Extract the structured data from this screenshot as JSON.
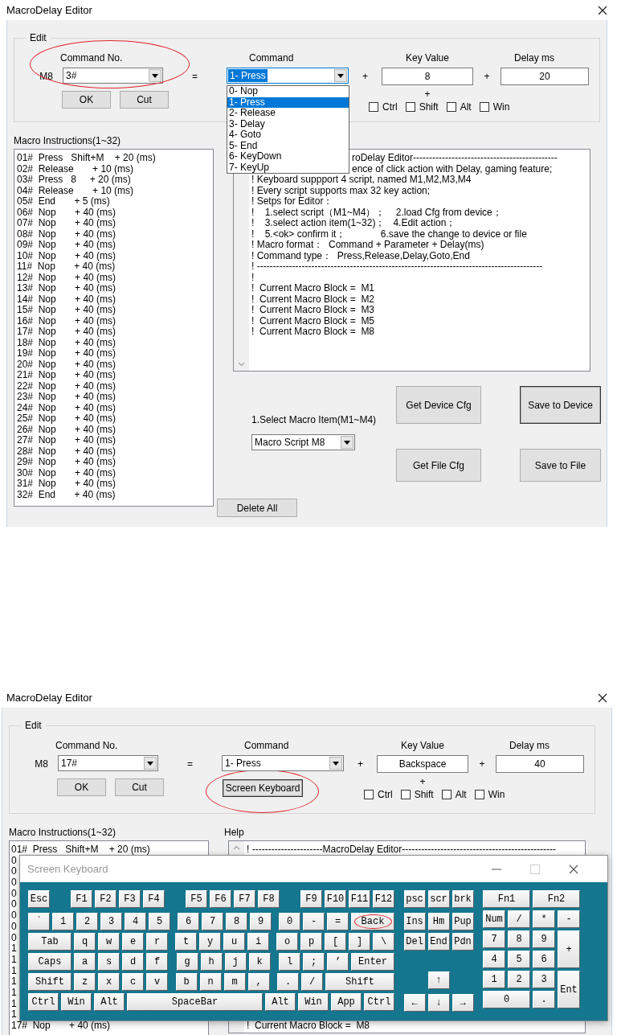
{
  "windows": [
    {
      "title": "MacroDelay Editor",
      "edit": {
        "legend": "Edit",
        "command_no": {
          "label": "Command No.",
          "prefix": "M8",
          "value": "3#",
          "highlighted": true
        },
        "equals": "=",
        "command": {
          "label": "Command",
          "value": "1- Press",
          "focused": true,
          "expanded": true,
          "options": [
            {
              "label": "0- Nop",
              "selected": false
            },
            {
              "label": "1- Press",
              "selected": true
            },
            {
              "label": "2- Release",
              "selected": false
            },
            {
              "label": "3- Delay",
              "selected": false
            },
            {
              "label": "4- Goto",
              "selected": false
            },
            {
              "label": "5- End",
              "selected": false
            },
            {
              "label": "6- KeyDown",
              "selected": false
            },
            {
              "label": "7- KeyUp",
              "selected": false
            }
          ]
        },
        "plus_1": "+",
        "key_value": {
          "label": "Key Value",
          "value": "8"
        },
        "plus_2": "+",
        "delay": {
          "label": "Delay ms",
          "value": "20"
        },
        "buttons": [
          "OK",
          "Cut"
        ],
        "plus_3": "+",
        "modifiers": [
          {
            "label": "Ctrl",
            "checked": false
          },
          {
            "label": "Shift",
            "checked": false
          },
          {
            "label": "Alt",
            "checked": false
          },
          {
            "label": "Win",
            "checked": false
          }
        ]
      },
      "macro_instructions": {
        "label": "Macro Instructions(1~32)",
        "rows": [
          "01#  Press   Shift+M    + 20 (ms)",
          "02#  Release       + 10 (ms)",
          "03#  Press   8     + 20 (ms)",
          "04#  Release       + 10 (ms)",
          "05#  End       + 5 (ms)",
          "06#  Nop       + 40 (ms)",
          "07#  Nop       + 40 (ms)",
          "08#  Nop       + 40 (ms)",
          "09#  Nop       + 40 (ms)",
          "10#  Nop       + 40 (ms)",
          "11#  Nop       + 40 (ms)",
          "12#  Nop       + 40 (ms)",
          "13#  Nop       + 40 (ms)",
          "14#  Nop       + 40 (ms)",
          "15#  Nop       + 40 (ms)",
          "16#  Nop       + 40 (ms)",
          "17#  Nop       + 40 (ms)",
          "18#  Nop       + 40 (ms)",
          "19#  Nop       + 40 (ms)",
          "20#  Nop       + 40 (ms)",
          "21#  Nop       + 40 (ms)",
          "22#  Nop       + 40 (ms)",
          "23#  Nop       + 40 (ms)",
          "24#  Nop       + 40 (ms)",
          "25#  Nop       + 40 (ms)",
          "26#  Nop       + 40 (ms)",
          "27#  Nop       + 40 (ms)",
          "28#  Nop       + 40 (ms)",
          "29#  Nop       + 40 (ms)",
          "30#  Nop       + 40 (ms)",
          "31#  Nop       + 40 (ms)",
          "32#  End       + 40 (ms)"
        ]
      },
      "help": {
        "lines": [
          {
            "kind": "cut",
            "text": "roDelay Editor---------------------------------------------"
          },
          {
            "kind": "cut",
            "text": "ence of click action with Delay, gaming feature;"
          },
          {
            "kind": "text",
            "text": "! Keyboard suppport 4 script, named M1,M2,M3,M4"
          },
          {
            "kind": "text",
            "text": "! Every script supports max 32 key action;"
          },
          {
            "kind": "text",
            "text": "! Setps for Editor："
          },
          {
            "kind": "text",
            "text": "!    1.select script（M1~M4）；    2.load Cfg from device；"
          },
          {
            "kind": "text",
            "text": "!    3.select action item(1~32)；   4.Edit action；"
          },
          {
            "kind": "text",
            "text": "!    5.<ok> confirm it；             6.save the change to device or file"
          },
          {
            "kind": "text",
            "text": "! Macro format：  Command + Parameter + Delay(ms)"
          },
          {
            "kind": "text",
            "text": "! Command type：  Press,Release,Delay,Goto,End"
          },
          {
            "kind": "text",
            "text": "! -----------------------------------------------------------------------------------------"
          },
          {
            "kind": "text",
            "text": "!"
          },
          {
            "kind": "text",
            "text": "!  Current Macro Block =  M1"
          },
          {
            "kind": "text",
            "text": "!  Current Macro Block =  M2"
          },
          {
            "kind": "text",
            "text": "!  Current Macro Block =  M3"
          },
          {
            "kind": "text",
            "text": "!  Current Macro Block =  M5"
          },
          {
            "kind": "text",
            "text": "!  Current Macro Block =  M8"
          }
        ]
      },
      "select_macro": {
        "label": "1.Select Macro Item(M1~M4)",
        "value": "Macro Script M8"
      },
      "action_buttons": [
        {
          "label": "Get Device Cfg",
          "default": false
        },
        {
          "label": "Save to Device",
          "default": true
        },
        {
          "label": "Get File Cfg",
          "default": false
        },
        {
          "label": "Save to File",
          "default": false
        }
      ],
      "delete_all": "Delete All"
    },
    {
      "title": "MacroDelay Editor",
      "edit": {
        "legend": "Edit",
        "command_no": {
          "label": "Command No.",
          "prefix": "M8",
          "value": "17#",
          "highlighted": false
        },
        "equals": "=",
        "command": {
          "label": "Command",
          "value": "1- Press",
          "focused": false,
          "expanded": false
        },
        "plus_1": "+",
        "key_value": {
          "label": "Key Value",
          "value": "Backspace"
        },
        "plus_2": "+",
        "delay": {
          "label": "Delay ms",
          "value": "40"
        },
        "buttons": [
          "OK",
          "Cut"
        ],
        "screen_keyboard_button": {
          "label": "Screen Keyboard",
          "default": true,
          "highlighted": true
        },
        "plus_3": "+",
        "modifiers": [
          {
            "label": "Ctrl",
            "checked": false
          },
          {
            "label": "Shift",
            "checked": false
          },
          {
            "label": "Alt",
            "checked": false
          },
          {
            "label": "Win",
            "checked": false
          }
        ]
      },
      "macro_instructions": {
        "label": "Macro Instructions(1~32)",
        "rows": [
          "01#  Press   Shift+M    + 20 (ms)",
          "0",
          "0",
          "0",
          "0",
          "0",
          "0",
          "0",
          "0",
          "1",
          "1",
          "1",
          "1",
          "1",
          "1",
          "1",
          "17#  Nop       + 40 (ms)"
        ]
      },
      "help": {
        "label": "Help",
        "lines": [
          {
            "kind": "text",
            "text": "! ----------------------MacroDelay Editor------------------------------------------------"
          },
          {
            "kind": "footer",
            "text": "!  Current Macro Block =  M8"
          }
        ]
      },
      "keyboard": {
        "title": "Screen Keyboard",
        "main_rows": [
          [
            [
              {
                "label": "Esc"
              }
            ],
            [
              {
                "label": "F1"
              },
              {
                "label": "F2"
              },
              {
                "label": "F3"
              },
              {
                "label": "F4"
              }
            ],
            [
              {
                "label": "F5"
              },
              {
                "label": "F6"
              },
              {
                "label": "F7"
              },
              {
                "label": "F8"
              }
            ],
            [
              {
                "label": "F9"
              },
              {
                "label": "F10"
              },
              {
                "label": "F11"
              },
              {
                "label": "F12"
              }
            ]
          ],
          [
            [
              {
                "label": "`"
              },
              {
                "label": "1"
              },
              {
                "label": "2"
              },
              {
                "label": "3"
              },
              {
                "label": "4"
              },
              {
                "label": "5"
              }
            ],
            [
              {
                "label": "6"
              },
              {
                "label": "7"
              },
              {
                "label": "8"
              },
              {
                "label": "9"
              }
            ],
            [
              {
                "label": "0"
              },
              {
                "label": "-"
              },
              {
                "label": "="
              },
              {
                "label": "Back",
                "kind": "wide",
                "highlighted": true
              }
            ]
          ],
          [
            [
              {
                "label": "Tab",
                "kind": "wide"
              },
              {
                "label": "q"
              },
              {
                "label": "w"
              },
              {
                "label": "e"
              },
              {
                "label": "r"
              }
            ],
            [
              {
                "label": "t"
              },
              {
                "label": "y"
              },
              {
                "label": "u"
              },
              {
                "label": "i"
              }
            ],
            [
              {
                "label": "o"
              },
              {
                "label": "p"
              },
              {
                "label": "["
              },
              {
                "label": "]"
              },
              {
                "label": "\\"
              }
            ]
          ],
          [
            [
              {
                "label": "Caps",
                "kind": "wide"
              },
              {
                "label": "a"
              },
              {
                "label": "s"
              },
              {
                "label": "d"
              },
              {
                "label": "f"
              }
            ],
            [
              {
                "label": "g"
              },
              {
                "label": "h"
              },
              {
                "label": "j"
              },
              {
                "label": "k"
              }
            ],
            [
              {
                "label": "l"
              },
              {
                "label": ";"
              },
              {
                "label": "’"
              },
              {
                "label": "Enter",
                "kind": "wide"
              }
            ]
          ],
          [
            [
              {
                "label": "Shift",
                "kind": "wide"
              },
              {
                "label": "z"
              },
              {
                "label": "x"
              },
              {
                "label": "c"
              },
              {
                "label": "v"
              }
            ],
            [
              {
                "label": "b"
              },
              {
                "label": "n"
              },
              {
                "label": "m"
              },
              {
                "label": ","
              }
            ],
            [
              {
                "label": "."
              },
              {
                "label": "/"
              },
              {
                "label": "Shift",
                "kind": "wider"
              }
            ]
          ],
          [
            [
              {
                "label": "Ctrl",
                "kind": "mod"
              },
              {
                "label": "Win",
                "kind": "mod"
              },
              {
                "label": "Alt",
                "kind": "mod"
              },
              {
                "label": "SpaceBar",
                "kind": "space"
              },
              {
                "label": "Alt",
                "kind": "mod"
              },
              {
                "label": "Win",
                "kind": "mod"
              },
              {
                "label": "App",
                "kind": "mod"
              },
              {
                "label": "Ctrl",
                "kind": "mod"
              }
            ]
          ]
        ],
        "nav_rows": [
          [
            {
              "label": "psc"
            },
            {
              "label": "scr"
            },
            {
              "label": "brk"
            }
          ],
          [
            {
              "label": "Ins"
            },
            {
              "label": "Hm"
            },
            {
              "label": "Pup"
            }
          ],
          [
            {
              "label": "Del"
            },
            {
              "label": "End"
            },
            {
              "label": "Pdn"
            }
          ]
        ],
        "arrow_rows": [
          [
            {
              "label": "↑"
            }
          ],
          [
            {
              "label": "←"
            },
            {
              "label": "↓"
            },
            {
              "label": "→"
            }
          ]
        ],
        "numpad": [
          {
            "label": "Fn1",
            "kind": "wide"
          },
          {
            "label": "Fn2",
            "kind": "wide"
          },
          {
            "label": "Num"
          },
          {
            "label": "/"
          },
          {
            "label": "*"
          },
          {
            "label": "-"
          },
          {
            "label": "7"
          },
          {
            "label": "8"
          },
          {
            "label": "9"
          },
          {
            "label": "+",
            "kind": "tall"
          },
          {
            "label": "4"
          },
          {
            "label": "5"
          },
          {
            "label": "6"
          },
          {
            "label": "1"
          },
          {
            "label": "2"
          },
          {
            "label": "3"
          },
          {
            "label": "Ent",
            "kind": "tall"
          },
          {
            "label": "0",
            "kind": "wide"
          },
          {
            "label": "."
          }
        ]
      }
    }
  ]
}
